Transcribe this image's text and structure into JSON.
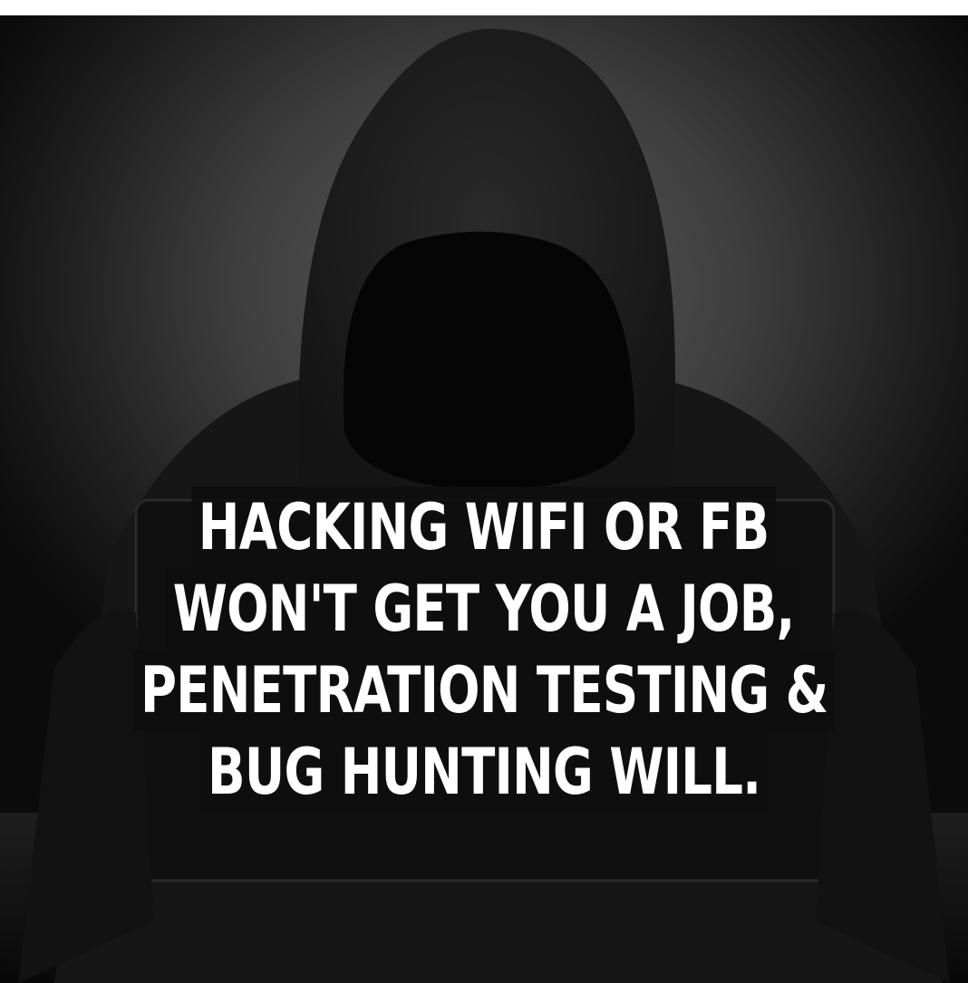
{
  "caption": {
    "lines": [
      "HACKING WIFI OR FB",
      "WON'T GET YOU A JOB,",
      "PENETRATION TESTING &",
      "BUG HUNTING WILL."
    ]
  },
  "colors": {
    "background_light": "#5a5a5a",
    "background_dark": "#0b0b0b",
    "hood": "#181818",
    "caption_text": "#ffffff",
    "caption_box": "#0e0e0e"
  },
  "scene": {
    "subject": "hooded-figure-with-laptop"
  }
}
